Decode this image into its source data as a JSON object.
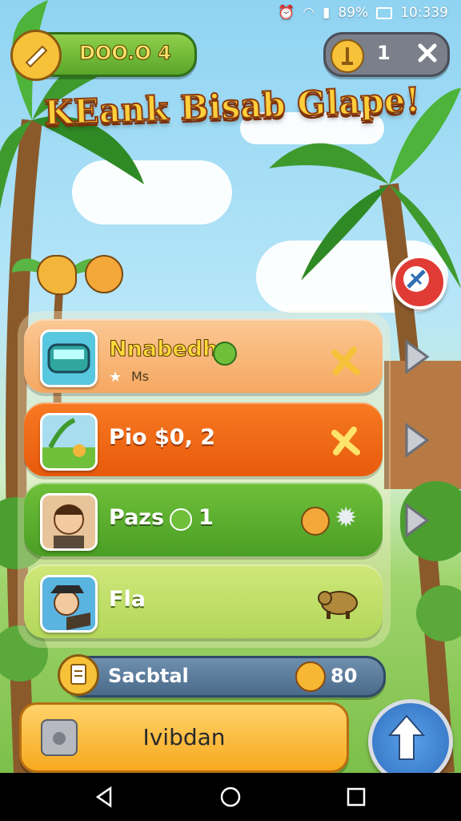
{
  "status_bar": {
    "battery": "89%",
    "time": "10:339"
  },
  "header": {
    "coin_value": "DOO.O 4",
    "key_count": "1",
    "title": "KEank Bisab Glape!"
  },
  "list": {
    "items": [
      {
        "name": "Nnabedh",
        "sub": "Ms",
        "color": "#f7b577"
      },
      {
        "name": "Pio $0, 2",
        "color": "#f06a16"
      },
      {
        "name": "Pazs",
        "count": "1",
        "color": "#5aae2f"
      },
      {
        "name": "Fla",
        "color": "#bfe06a"
      }
    ]
  },
  "subtotal": {
    "label": "Sacbtal",
    "value": "80"
  },
  "action_button": {
    "label": "Ivibdan"
  },
  "colors": {
    "accent": "#f7b733",
    "green": "#6fbf3a",
    "orange": "#f06a16"
  }
}
